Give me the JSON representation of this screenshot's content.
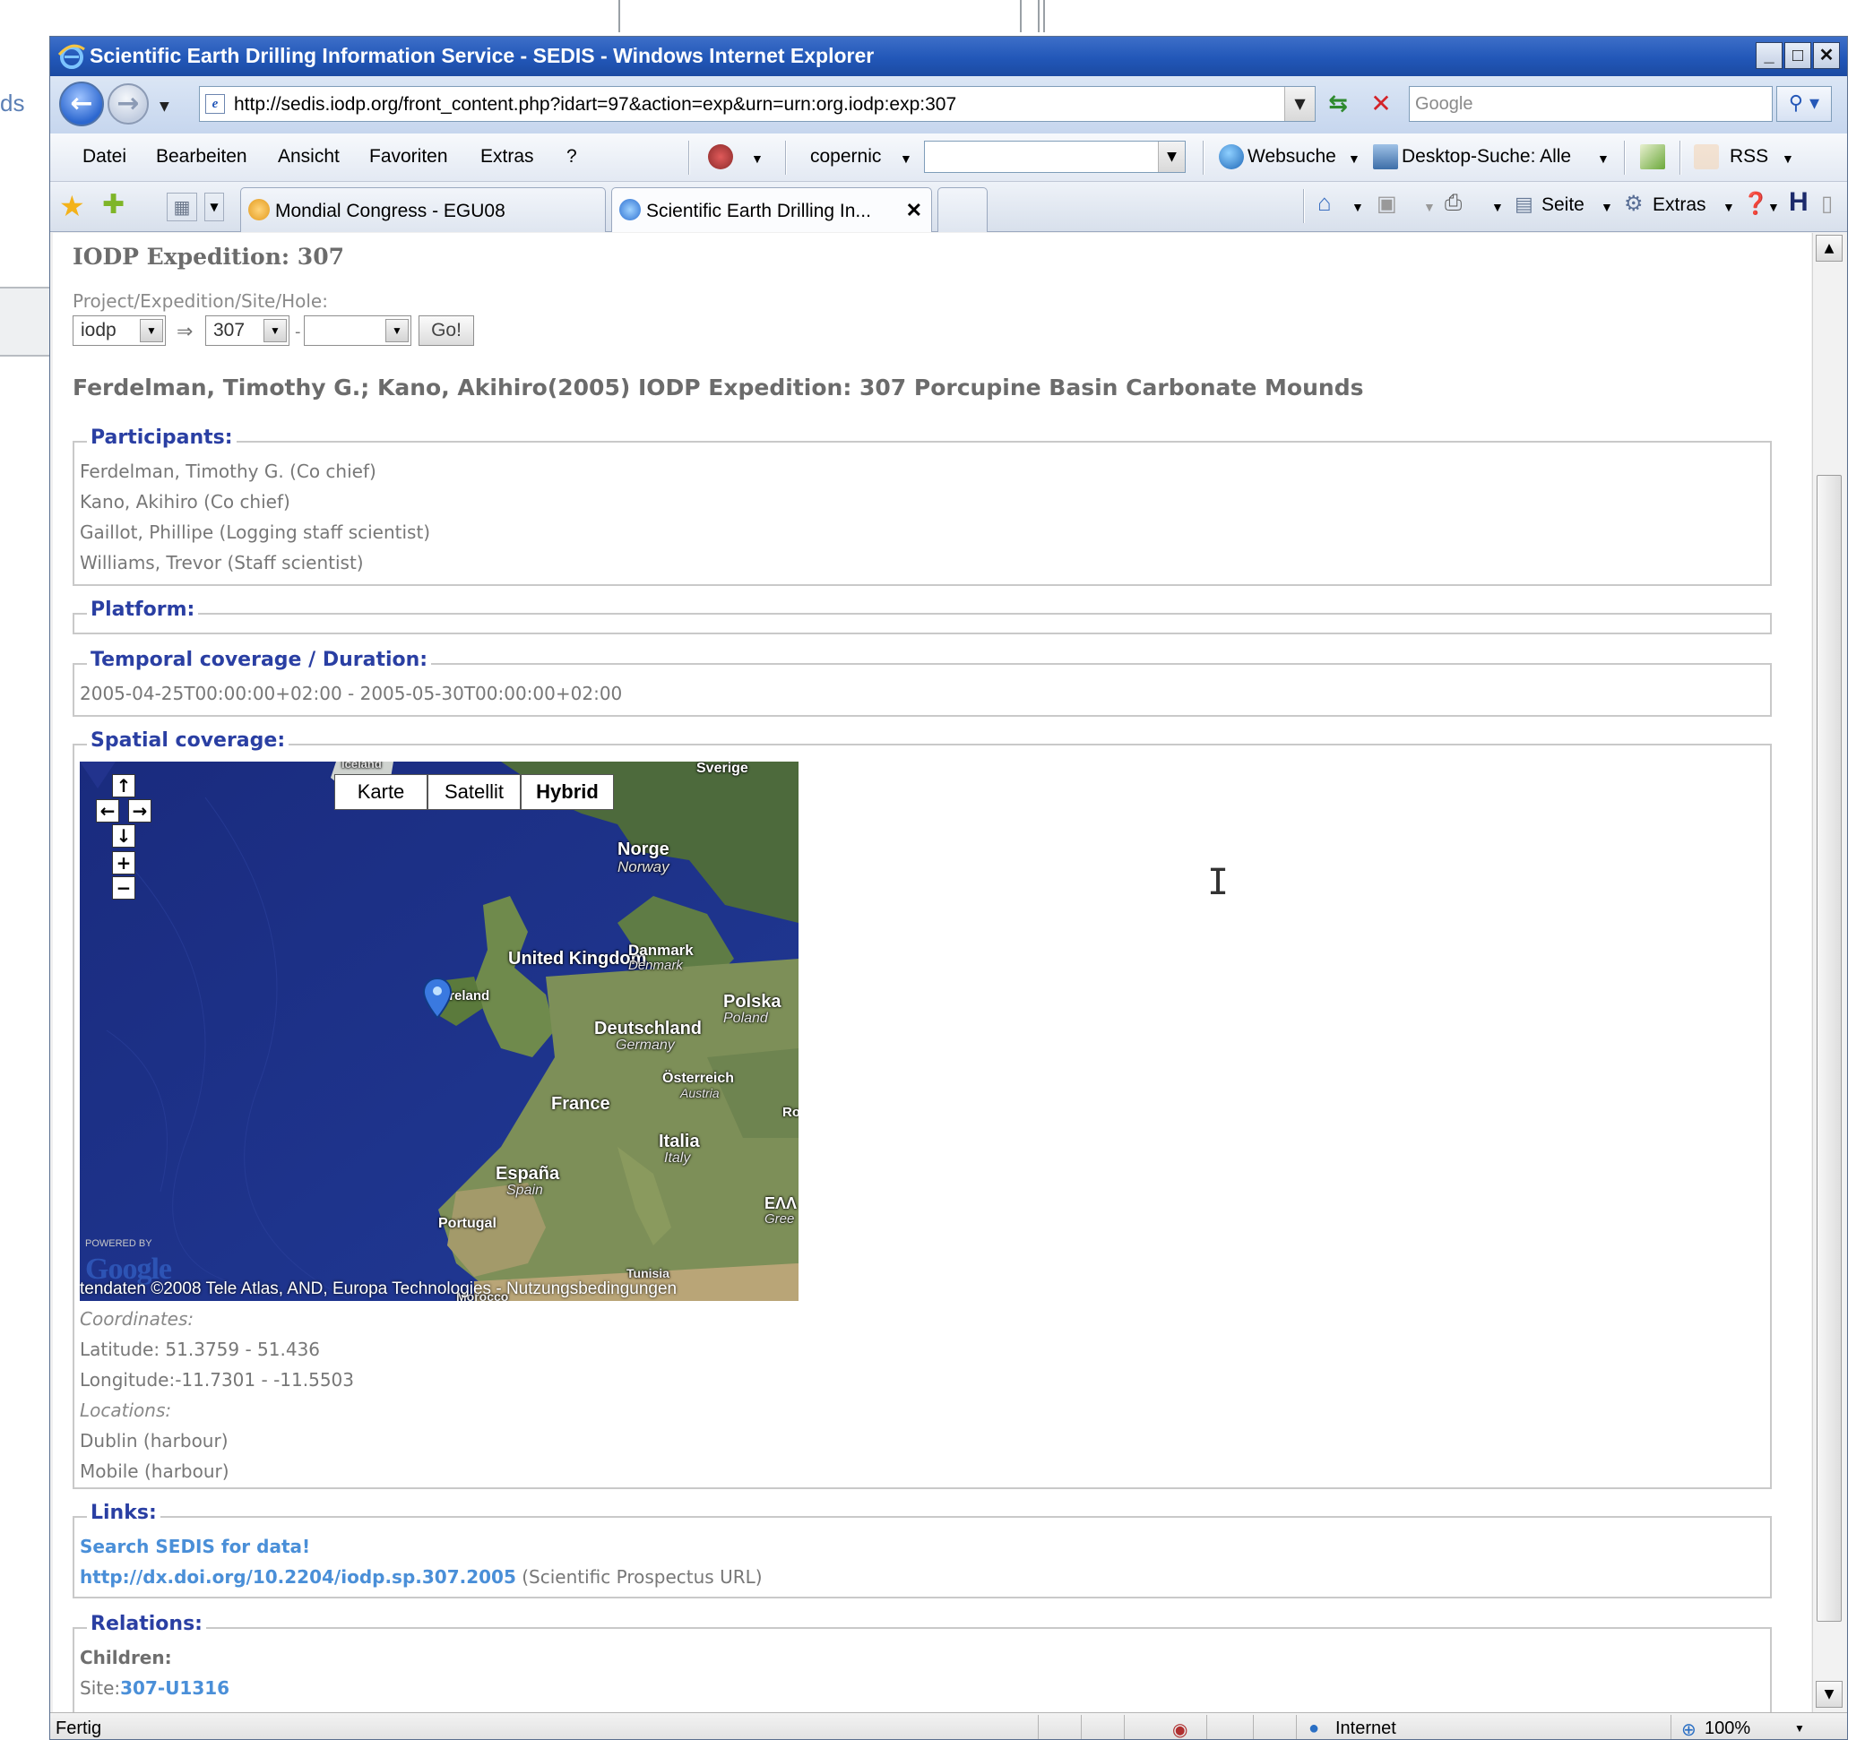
{
  "background": {
    "left_fragment": "ds"
  },
  "window": {
    "title": "Scientific Earth Drilling Information Service - SEDIS - Windows Internet Explorer",
    "controls": {
      "minimize": "_",
      "maximize": "□",
      "close": "✕"
    }
  },
  "address": {
    "url": "http://sedis.iodp.org/front_content.php?idart=97&action=exp&urn=urn:org.iodp:exp:307",
    "search_placeholder": "Google"
  },
  "menu": {
    "items": [
      "Datei",
      "Bearbeiten",
      "Ansicht",
      "Favoriten",
      "Extras",
      "?"
    ],
    "copernic": "copernic",
    "websuche": "Websuche",
    "desktop_search": "Desktop-Suche: Alle",
    "rss": "RSS"
  },
  "tabs": [
    {
      "label": "Mondial Congress - EGU08"
    },
    {
      "label": "Scientific Earth Drilling In...",
      "active": true
    },
    {
      "label": ""
    }
  ],
  "command_bar": {
    "page": "Seite",
    "tools": "Extras"
  },
  "page": {
    "heading": "IODP Expedition: 307",
    "selector_label": "Project/Expedition/Site/Hole:",
    "project_value": "iodp",
    "expedition_value": "307",
    "site_value": "",
    "go_label": "Go!",
    "citation": "Ferdelman, Timothy G.; Kano, Akihiro(2005) IODP Expedition: 307 Porcupine Basin Carbonate Mounds",
    "participants": {
      "legend": "Participants:",
      "items": [
        "Ferdelman, Timothy G. (Co chief)",
        "Kano, Akihiro (Co chief)",
        "Gaillot, Phillipe (Logging staff scientist)",
        "Williams, Trevor (Staff scientist)"
      ]
    },
    "platform": {
      "legend": "Platform:"
    },
    "temporal": {
      "legend": "Temporal coverage / Duration:",
      "value": "2005-04-25T00:00:00+02:00 - 2005-05-30T00:00:00+02:00"
    },
    "spatial": {
      "legend": "Spatial coverage:",
      "map": {
        "types": [
          "Karte",
          "Satellit",
          "Hybrid"
        ],
        "selected_type": "Hybrid",
        "labels": {
          "iceland": "Iceland",
          "sverige": "Sverige",
          "norge": "Norge",
          "norway": "Norway",
          "uk": "United Kingdom",
          "ireland": "Ireland",
          "danmark": "Danmark",
          "denmark": "Denmark",
          "polska": "Polska",
          "poland": "Poland",
          "deutschland": "Deutschland",
          "germany": "Germany",
          "oesterreich": "Österreich",
          "austria": "Austria",
          "france": "France",
          "italia": "Italia",
          "italy": "Italy",
          "espana": "España",
          "spain": "Spain",
          "portugal": "Portugal",
          "greece": "ΕΛΛ",
          "greece_en": "Gree",
          "ro": "Ro",
          "tunisia": "Tunisia",
          "morocco": "Morocco"
        },
        "powered_by": "POWERED BY",
        "copyright": "tendaten ©2008 Tele Atlas, AND, Europa Technologies - Nutzungsbedingungen"
      },
      "coordinates_label": "Coordinates:",
      "latitude": "Latitude: 51.3759 - 51.436",
      "longitude": "Longitude:-11.7301 - -11.5503",
      "locations_label": "Locations:",
      "locations": [
        "Dublin (harbour)",
        "Mobile (harbour)"
      ]
    },
    "links": {
      "legend": "Links:",
      "search_link": "Search SEDIS for data!",
      "doi_link": "http://dx.doi.org/10.2204/iodp.sp.307.2005",
      "doi_note": "(Scientific Prospectus URL)"
    },
    "relations": {
      "legend": "Relations:",
      "children_label": "Children:",
      "site_prefix": "Site:",
      "site_link": "307-U1316"
    }
  },
  "status": {
    "text": "Fertig",
    "zone": "Internet",
    "zoom": "100%"
  },
  "colors": {
    "title_bar": "#2257b8",
    "legend": "#2a3fa3",
    "link": "#4a8fd8",
    "ocean": "#1b2f86"
  }
}
